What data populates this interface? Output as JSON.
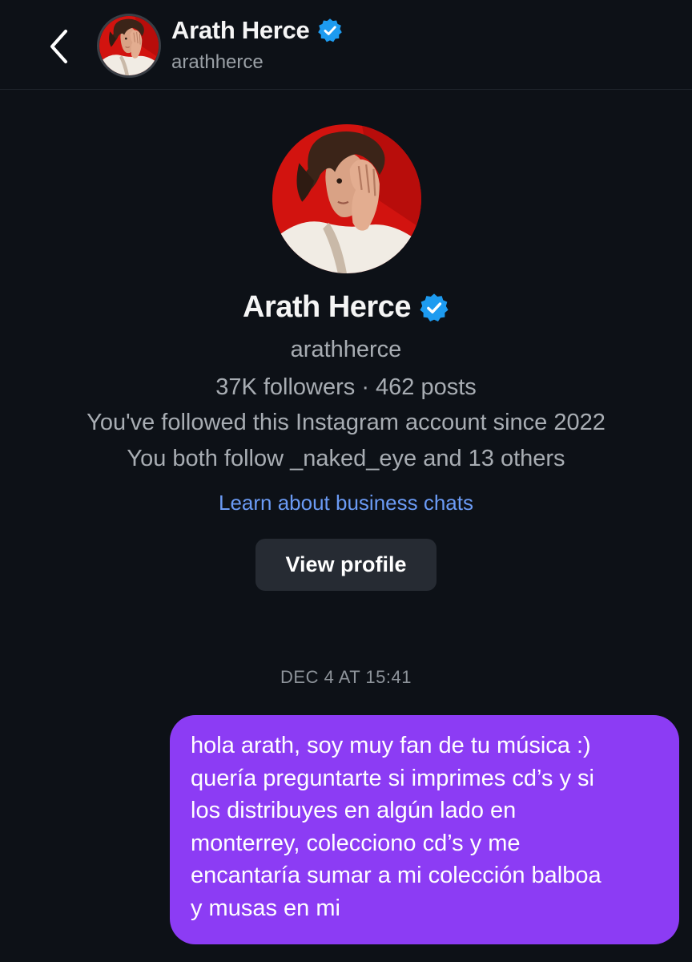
{
  "header": {
    "name": "Arath Herce",
    "username": "arathherce",
    "verified": true
  },
  "profile": {
    "name": "Arath Herce",
    "username": "arathherce",
    "stats": "37K followers · 462 posts",
    "followed_since": "You've followed this Instagram account since 2022",
    "mutuals": "You both follow _naked_eye and 13 others",
    "business_link": "Learn about business chats",
    "view_profile_label": "View profile"
  },
  "thread": {
    "timestamp": "DEC 4 AT 15:41",
    "messages": [
      {
        "direction": "outgoing",
        "lines": [
          "hola arath, soy muy fan de tu música :)",
          "quería preguntarte si imprimes cd’s y si",
          "los distribuyes en algún lado en",
          "monterrey, colecciono cd’s y me",
          "encantaría sumar a mi colección balboa",
          "y musas en mi"
        ]
      }
    ]
  },
  "icons": {
    "back": "chevron-left-icon",
    "verified": "verified-badge-icon"
  },
  "colors": {
    "background": "#0d1117",
    "outgoing_bubble": "#8c3cf4",
    "link": "#6b9bf5",
    "verified_badge": "#1d9bf0",
    "button_bg": "#262b33"
  }
}
